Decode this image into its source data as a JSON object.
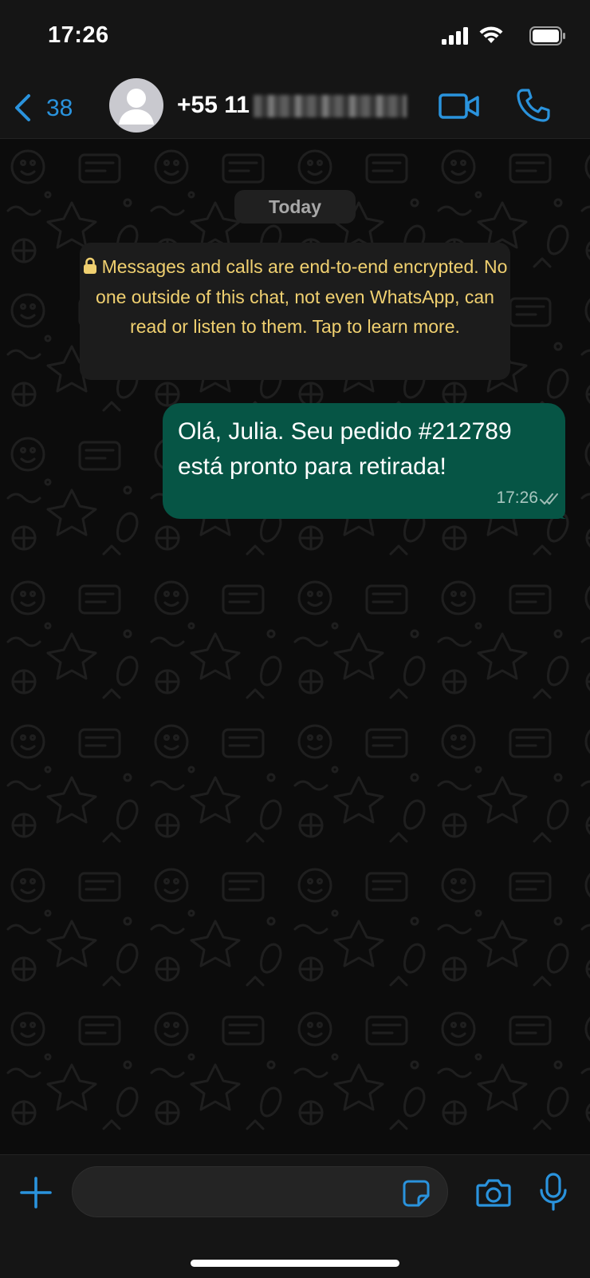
{
  "status_bar": {
    "time": "17:26",
    "icons": [
      "signal-icon",
      "wifi-icon",
      "battery-icon"
    ]
  },
  "header": {
    "back_count": "38",
    "contact_name": "+55 11",
    "contact_number_obscured": true,
    "icons": [
      "chevron-left-icon",
      "avatar-icon",
      "video-call-icon",
      "phone-icon"
    ],
    "accent_color": "#2a93dd"
  },
  "chat": {
    "date_chip": "Today",
    "encryption_notice": "Messages and calls are end-to-end encrypted. No one outside of this chat, not even WhatsApp, can read or listen to them. Tap to learn more.",
    "notice_color": "#f0d070",
    "messages": [
      {
        "direction": "outgoing",
        "text": "Olá, Julia. Seu pedido #212789 está pronto para retirada!",
        "time": "17:26",
        "status": "delivered",
        "bubble_color": "#065545"
      }
    ]
  },
  "input_bar": {
    "value": "",
    "icons": [
      "plus-icon",
      "sticker-icon",
      "camera-icon",
      "microphone-icon"
    ]
  }
}
